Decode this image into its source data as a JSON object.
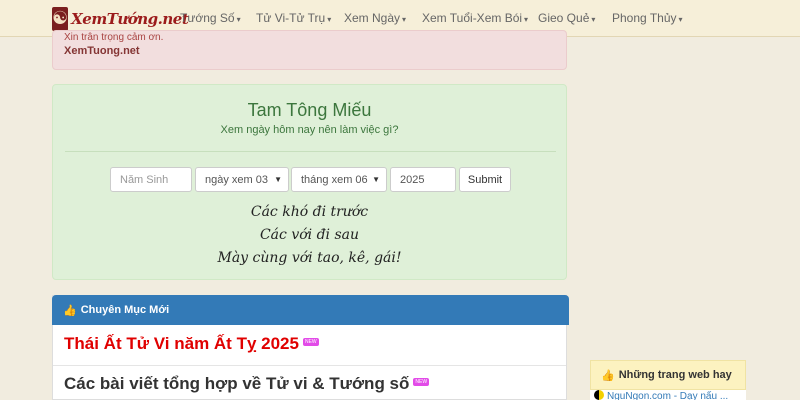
{
  "brand": {
    "name": "XemTướng.net",
    "logo_icon": "yin-yang-icon"
  },
  "nav": [
    {
      "label": "Tướng Số",
      "caret": "▾"
    },
    {
      "label": "Tử Vi-Tử Trụ",
      "caret": "▾"
    },
    {
      "label": "Xem Ngày",
      "caret": "▾"
    },
    {
      "label": "Xem Tuổi-Xem Bói",
      "caret": "▾"
    },
    {
      "label": "Gieo Quẻ",
      "caret": "▾"
    },
    {
      "label": "Phong Thủy",
      "caret": "▾"
    }
  ],
  "alert": {
    "cut_text": "Xin trân trọng cảm ơn.",
    "link": "XemTuong.net"
  },
  "panel": {
    "title": "Tam Tông Miếu",
    "subtitle": "Xem ngày hôm nay nên làm việc gì?",
    "form": {
      "birth_year_placeholder": "Năm Sinh",
      "day_select": "ngày xem 03",
      "month_select": "tháng xem 06",
      "year_value": "2025",
      "submit_label": "Submit"
    },
    "poem": [
      "Các khó đi trước",
      "Các với đi sau",
      "Mày cùng với tao, kê, gái!"
    ]
  },
  "categories": {
    "title": "Chuyên Mục Mới",
    "icon": "thumbs-up-icon",
    "items": [
      {
        "title": "Thái Ất Tử Vi năm Ất Tỵ 2025",
        "badge": "NEW",
        "color": "#e00000"
      },
      {
        "title": "Các bài viết tổng hợp về Tử vi & Tướng số",
        "badge": "NEW",
        "color": "#333333"
      }
    ]
  },
  "sidebar": {
    "title": "Những trang web hay",
    "icon": "thumbs-up-icon",
    "items": [
      {
        "label": "NguNgon.com - Dạy nấu ..."
      }
    ]
  },
  "colors": {
    "nav_bg": "#f6efd9",
    "panel_bg": "#dff0d8",
    "category_header": "#337ab7",
    "sidebar_header": "#fcf2c0"
  }
}
